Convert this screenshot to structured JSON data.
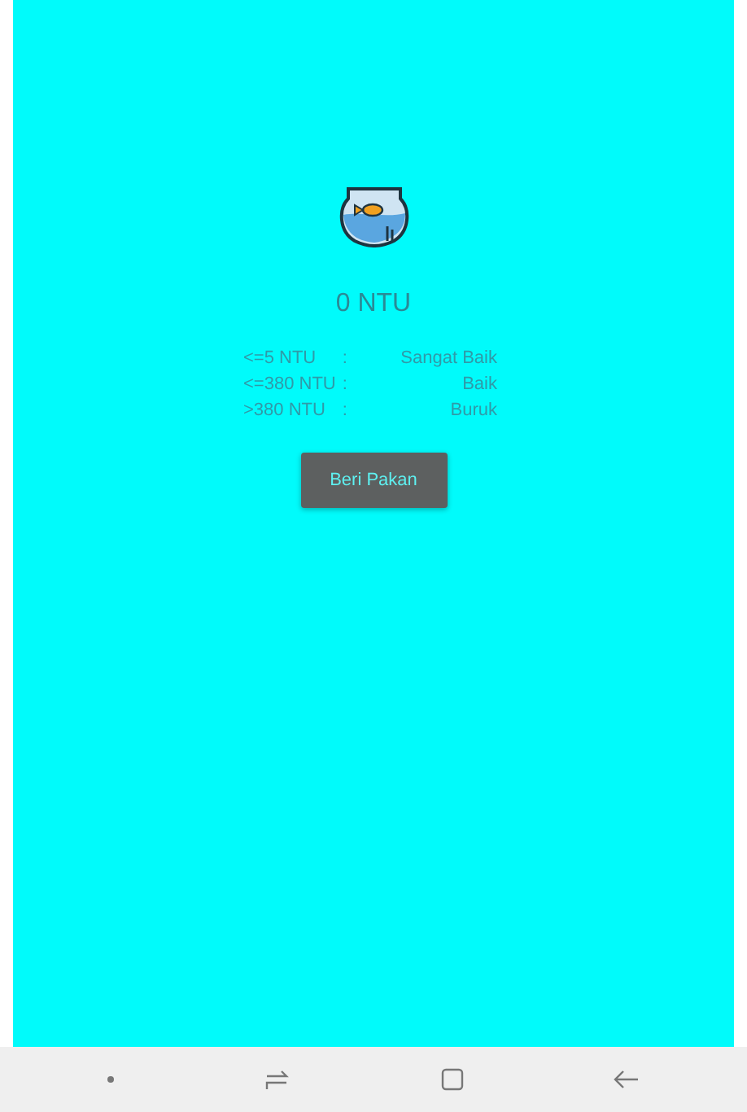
{
  "reading": "0 NTU",
  "scale": [
    {
      "range": "<=5 NTU",
      "separator": ":",
      "grade": "Sangat Baik"
    },
    {
      "range": "<=380 NTU",
      "separator": ":",
      "grade": "Baik"
    },
    {
      "range": ">380 NTU",
      "separator": ":",
      "grade": "Buruk"
    }
  ],
  "button": "Beri Pakan"
}
